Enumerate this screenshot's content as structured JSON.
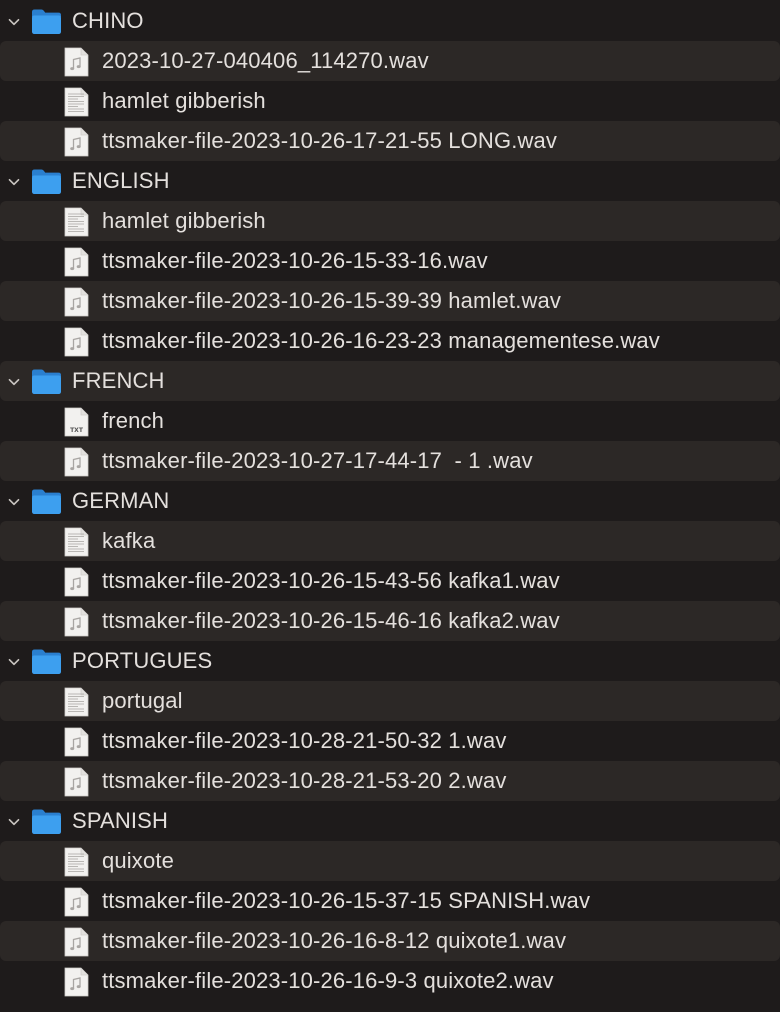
{
  "folders": [
    {
      "name": "CHINO",
      "expanded": true,
      "files": [
        {
          "name": "2023-10-27-040406_114270.wav",
          "kind": "audio"
        },
        {
          "name": "hamlet gibberish",
          "kind": "document"
        },
        {
          "name": "ttsmaker-file-2023-10-26-17-21-55 LONG.wav",
          "kind": "audio"
        }
      ]
    },
    {
      "name": "ENGLISH",
      "expanded": true,
      "files": [
        {
          "name": "hamlet gibberish",
          "kind": "document"
        },
        {
          "name": "ttsmaker-file-2023-10-26-15-33-16.wav",
          "kind": "audio"
        },
        {
          "name": "ttsmaker-file-2023-10-26-15-39-39 hamlet.wav",
          "kind": "audio"
        },
        {
          "name": "ttsmaker-file-2023-10-26-16-23-23 managementese.wav",
          "kind": "audio"
        }
      ]
    },
    {
      "name": "FRENCH",
      "expanded": true,
      "files": [
        {
          "name": "french",
          "kind": "text",
          "badge": "TXT"
        },
        {
          "name": "ttsmaker-file-2023-10-27-17-44-17  - 1 .wav",
          "kind": "audio"
        }
      ]
    },
    {
      "name": "GERMAN",
      "expanded": true,
      "files": [
        {
          "name": "kafka",
          "kind": "document"
        },
        {
          "name": "ttsmaker-file-2023-10-26-15-43-56 kafka1.wav",
          "kind": "audio"
        },
        {
          "name": "ttsmaker-file-2023-10-26-15-46-16 kafka2.wav",
          "kind": "audio"
        }
      ]
    },
    {
      "name": "PORTUGUES",
      "expanded": true,
      "files": [
        {
          "name": "portugal",
          "kind": "document"
        },
        {
          "name": "ttsmaker-file-2023-10-28-21-50-32 1.wav",
          "kind": "audio"
        },
        {
          "name": "ttsmaker-file-2023-10-28-21-53-20 2.wav",
          "kind": "audio"
        }
      ]
    },
    {
      "name": "SPANISH",
      "expanded": true,
      "files": [
        {
          "name": "quixote",
          "kind": "document"
        },
        {
          "name": "ttsmaker-file-2023-10-26-15-37-15 SPANISH.wav",
          "kind": "audio"
        },
        {
          "name": "ttsmaker-file-2023-10-26-16-8-12 quixote1.wav",
          "kind": "audio"
        },
        {
          "name": "ttsmaker-file-2023-10-26-16-9-3 quixote2.wav",
          "kind": "audio"
        }
      ]
    }
  ],
  "colors": {
    "background": "#1e1b1b",
    "stripe": "#2c2826",
    "text": "#e4e0dd",
    "folder": "#3d9fef",
    "folder_dark": "#2a7fcf",
    "chevron": "#c8c4c0"
  }
}
